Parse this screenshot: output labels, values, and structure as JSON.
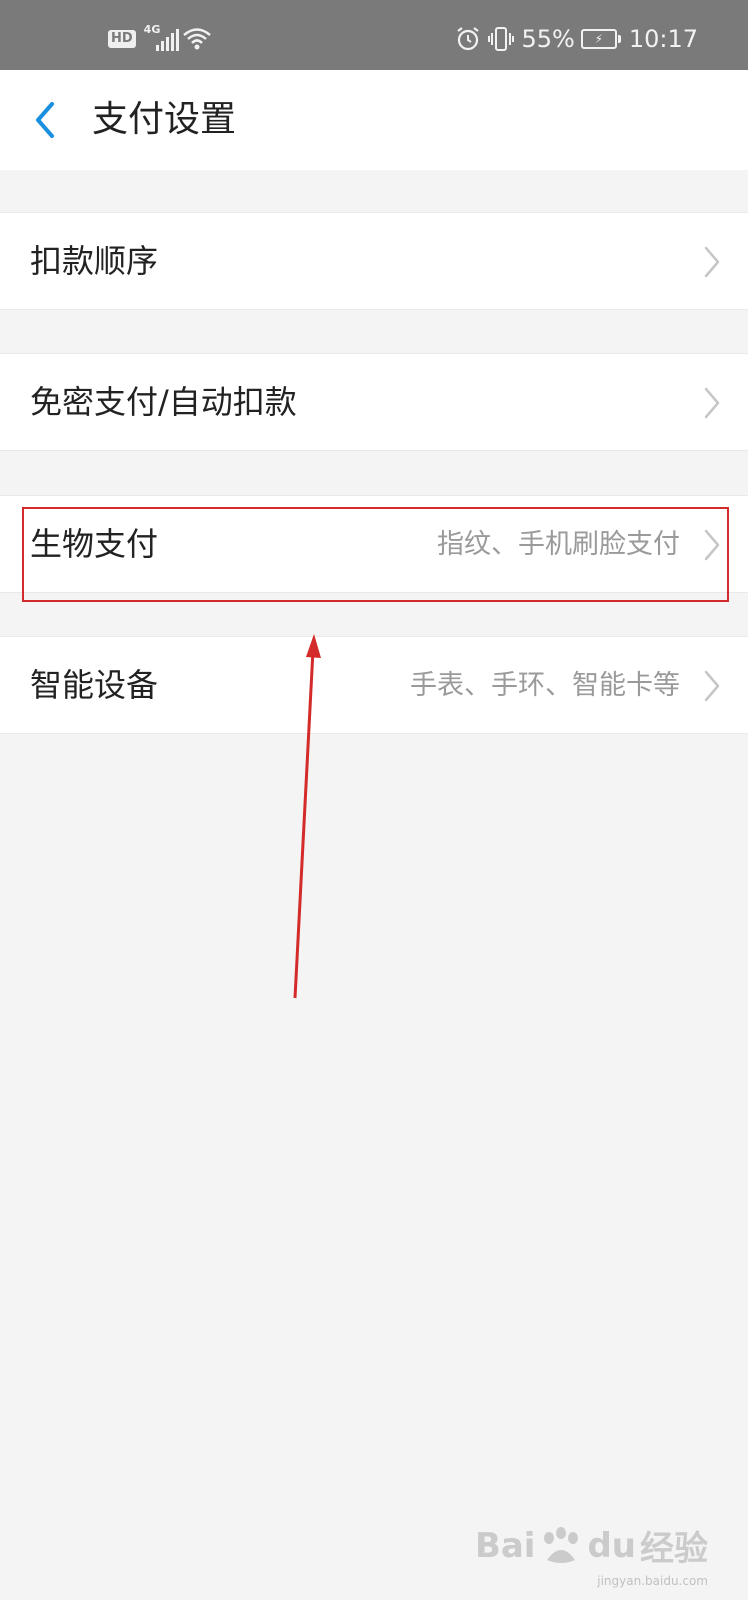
{
  "status_bar": {
    "hd_badge": "HD",
    "network": "4G",
    "battery_percent": "55%",
    "time": "10:17",
    "icons": [
      "hd-icon",
      "signal-icon",
      "wifi-icon",
      "alarm-icon",
      "vibrate-icon",
      "battery-charging-icon"
    ]
  },
  "header": {
    "title": "支付设置",
    "back_icon": "chevron-left-icon"
  },
  "settings": [
    {
      "label": "扣款顺序",
      "value": ""
    },
    {
      "label": "免密支付/自动扣款",
      "value": ""
    },
    {
      "label": "生物支付",
      "value": "指纹、手机刷脸支付"
    },
    {
      "label": "智能设备",
      "value": "手表、手环、智能卡等"
    }
  ],
  "annotation": {
    "highlight_color": "#d42a2a",
    "highlighted_item": "生物支付"
  },
  "watermark": {
    "brand_left": "Bai",
    "brand_mid": "du",
    "brand_right": "经验",
    "url": "jingyan.baidu.com"
  },
  "colors": {
    "accent": "#1a8fe0",
    "status_bar": "#7a7a7a",
    "background": "#f4f4f4",
    "secondary_text": "#9a9a9a"
  }
}
